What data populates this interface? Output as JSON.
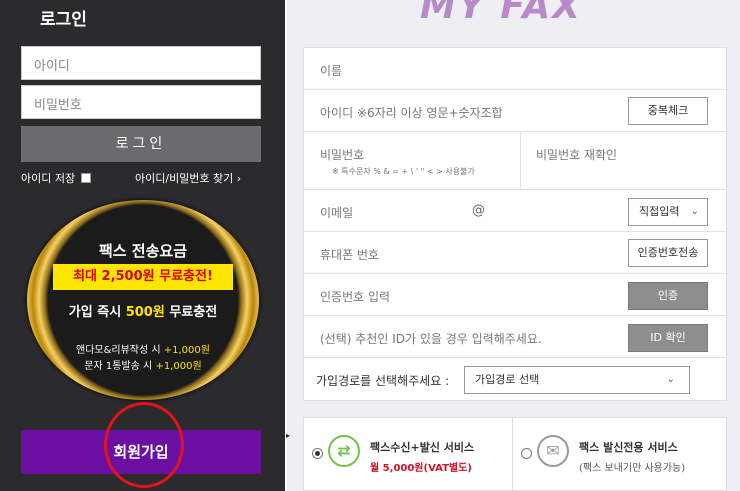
{
  "left_panel": {
    "title": "로그인",
    "id_placeholder": "아이디",
    "pw_placeholder": "비밀번호",
    "login_label": "로그인",
    "save_id_label": "아이디 저장",
    "find_link": "아이디/비밀번호 찾기 ›",
    "promo": {
      "title": "팩스 전송요금",
      "yellow": "최대 2,500원 무료충전!",
      "line2_a": "가입 즉시 ",
      "line2_b": "500원",
      "line2_c": " 무료충전",
      "line3_a": "앤다모&리뷰작성 시 ",
      "line3_b": "+1,000원",
      "line4_a": "문자 1통발송 시 ",
      "line4_b": "+1,000원"
    },
    "signup_label": "회원가입"
  },
  "logo": "MY FAX",
  "form": {
    "name_label": "이름",
    "id_label": "아이디 ※6자리 이상 영문+숫자조합",
    "dup_check": "중복체크",
    "pw_label": "비밀번호",
    "pw_confirm_label": "비밀번호 재확인",
    "pw_note": "※ 특수문자 % & = + \\ ' \" < > 사용불가",
    "email_label": "이메일",
    "email_at": "@",
    "email_select": "직접입력",
    "phone_label": "휴대폰 번호",
    "send_code": "인증번호전송",
    "code_label": "인증번호 입력",
    "verify": "인증",
    "referrer_label": "(선택) 추천인 ID가 있을 경우 입력해주세요.",
    "id_check": "ID 확인",
    "route_label": "가입경로를 선택해주세요 :",
    "route_select": "가입경로 선택"
  },
  "services": [
    {
      "title": "팩스수신+발신 서비스",
      "sub": "월 5,000원(VAT별도)",
      "icon": "exchange-icon",
      "selected": true
    },
    {
      "title": "팩스 발신전용 서비스",
      "sub": "(팩스 보내기만 사용가능)",
      "icon": "envelope-icon",
      "selected": false
    }
  ],
  "colors": {
    "purple": "#6a0fa2",
    "yellow": "#ffe400",
    "red_circle": "#e1141e",
    "green": "#78c04a"
  }
}
